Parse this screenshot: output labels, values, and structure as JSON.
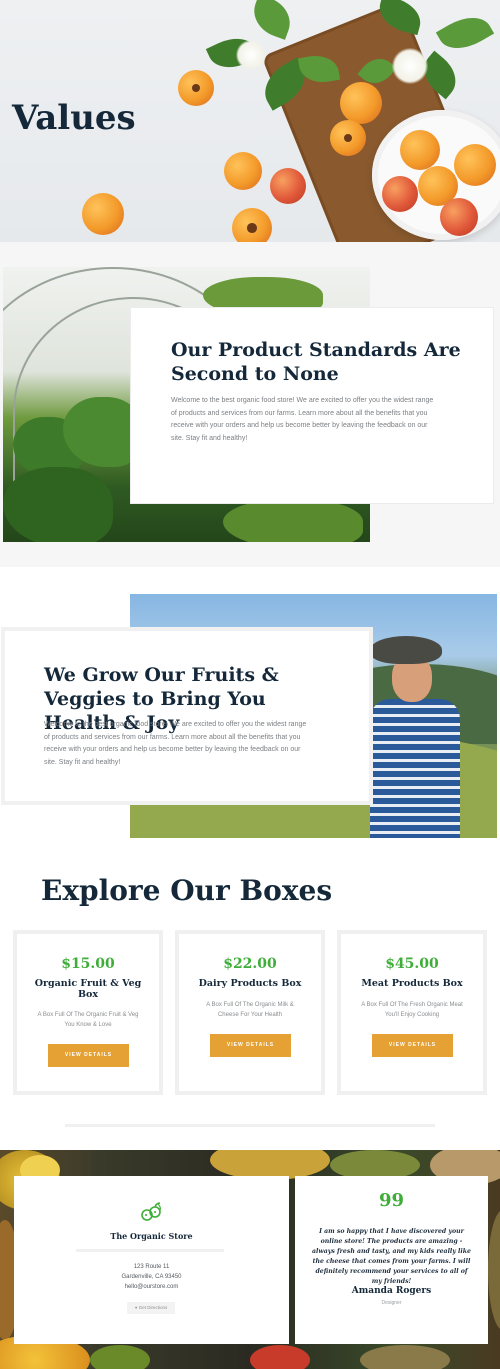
{
  "hero": {
    "title": "Values"
  },
  "standards": {
    "heading": "Our Product Standards Are Second to None",
    "body": "Welcome to the best organic food store! We are excited to offer you the widest range of products and services from our farms. Learn more about all the benefits that you receive with your orders and help us become better by leaving the feedback on our site. Stay fit and healthy!"
  },
  "grow": {
    "heading": "We Grow Our Fruits & Veggies to Bring You Health & Joy",
    "body": "Welcome to the best organic food store! We are excited to offer you the widest range of products and services from our farms. Learn more about all the benefits that you receive with your orders and help us become better by leaving the feedback on our site. Stay fit and healthy!"
  },
  "boxes": {
    "title": "Explore Our Boxes",
    "items": [
      {
        "price": "$15.00",
        "name": "Organic Fruit & Veg Box",
        "desc": "A Box Full Of The Organic Fruit & Veg You Know & Love",
        "button": "VIEW DETAILS"
      },
      {
        "price": "$22.00",
        "name": "Dairy Products Box",
        "desc": "A Box Full Of The Organic Milk & Cheese For Your Health",
        "button": "VIEW DETAILS"
      },
      {
        "price": "$45.00",
        "name": "Meat Products Box",
        "desc": "A Box Full Of The Fresh Organic Meat You'll Enjoy Cooking",
        "button": "VIEW DETAILS"
      }
    ]
  },
  "store": {
    "name": "The Organic Store",
    "address1": "123 Route 11",
    "address2": "Gardenville, CA 93450",
    "email": "hello@ourstore.com",
    "directions": "Get Directions"
  },
  "testimonial": {
    "quote_mark": "99",
    "text": "I am so happy that I have discovered your online store! The products are amazing - always fresh and tasty, and my kids really like the cheese that comes from your farms. I will definitely recommend your services to all of my friends!",
    "name": "Amanda Rogers",
    "role": "Designer"
  },
  "colors": {
    "accent_green": "#3fae39",
    "button_orange": "#e5a133",
    "heading_navy": "#14283a"
  }
}
